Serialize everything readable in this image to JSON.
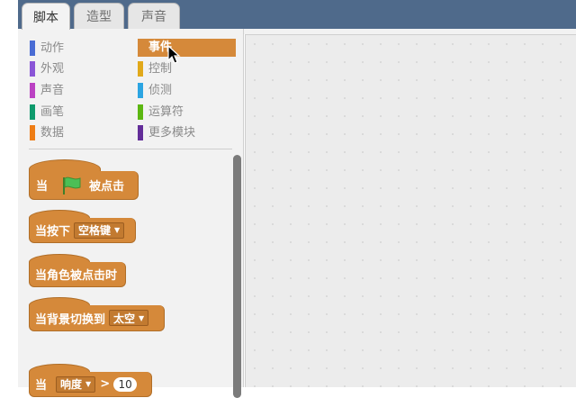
{
  "tabs": [
    {
      "label": "脚本"
    },
    {
      "label": "造型"
    },
    {
      "label": "声音"
    }
  ],
  "categories": [
    {
      "label": "动作",
      "color": "#4a6cd4"
    },
    {
      "label": "外观",
      "color": "#8a55d7"
    },
    {
      "label": "声音",
      "color": "#bb42c3"
    },
    {
      "label": "画笔",
      "color": "#0e9a6c"
    },
    {
      "label": "数据",
      "color": "#ee7d16"
    },
    {
      "label": "事件",
      "color": "#c88330",
      "selected": true
    },
    {
      "label": "控制",
      "color": "#e1a91a"
    },
    {
      "label": "侦测",
      "color": "#2ca5e2"
    },
    {
      "label": "运算符",
      "color": "#5cb712"
    },
    {
      "label": "更多模块",
      "color": "#632d99"
    }
  ],
  "blocks": {
    "flag_clicked": {
      "when": "当",
      "clicked": "被点击",
      "flag_icon": "green-flag-icon"
    },
    "key_pressed": {
      "label": "当按下",
      "key": "空格键"
    },
    "sprite_clicked": {
      "label": "当角色被点击时"
    },
    "backdrop_switch": {
      "label": "当背景切换到",
      "backdrop": "太空"
    },
    "sensor_gt": {
      "when": "当",
      "sensor": "响度",
      "op": ">",
      "value": "10"
    }
  },
  "colors": {
    "events": "#d5893a",
    "topbar": "#4f6a8b"
  }
}
